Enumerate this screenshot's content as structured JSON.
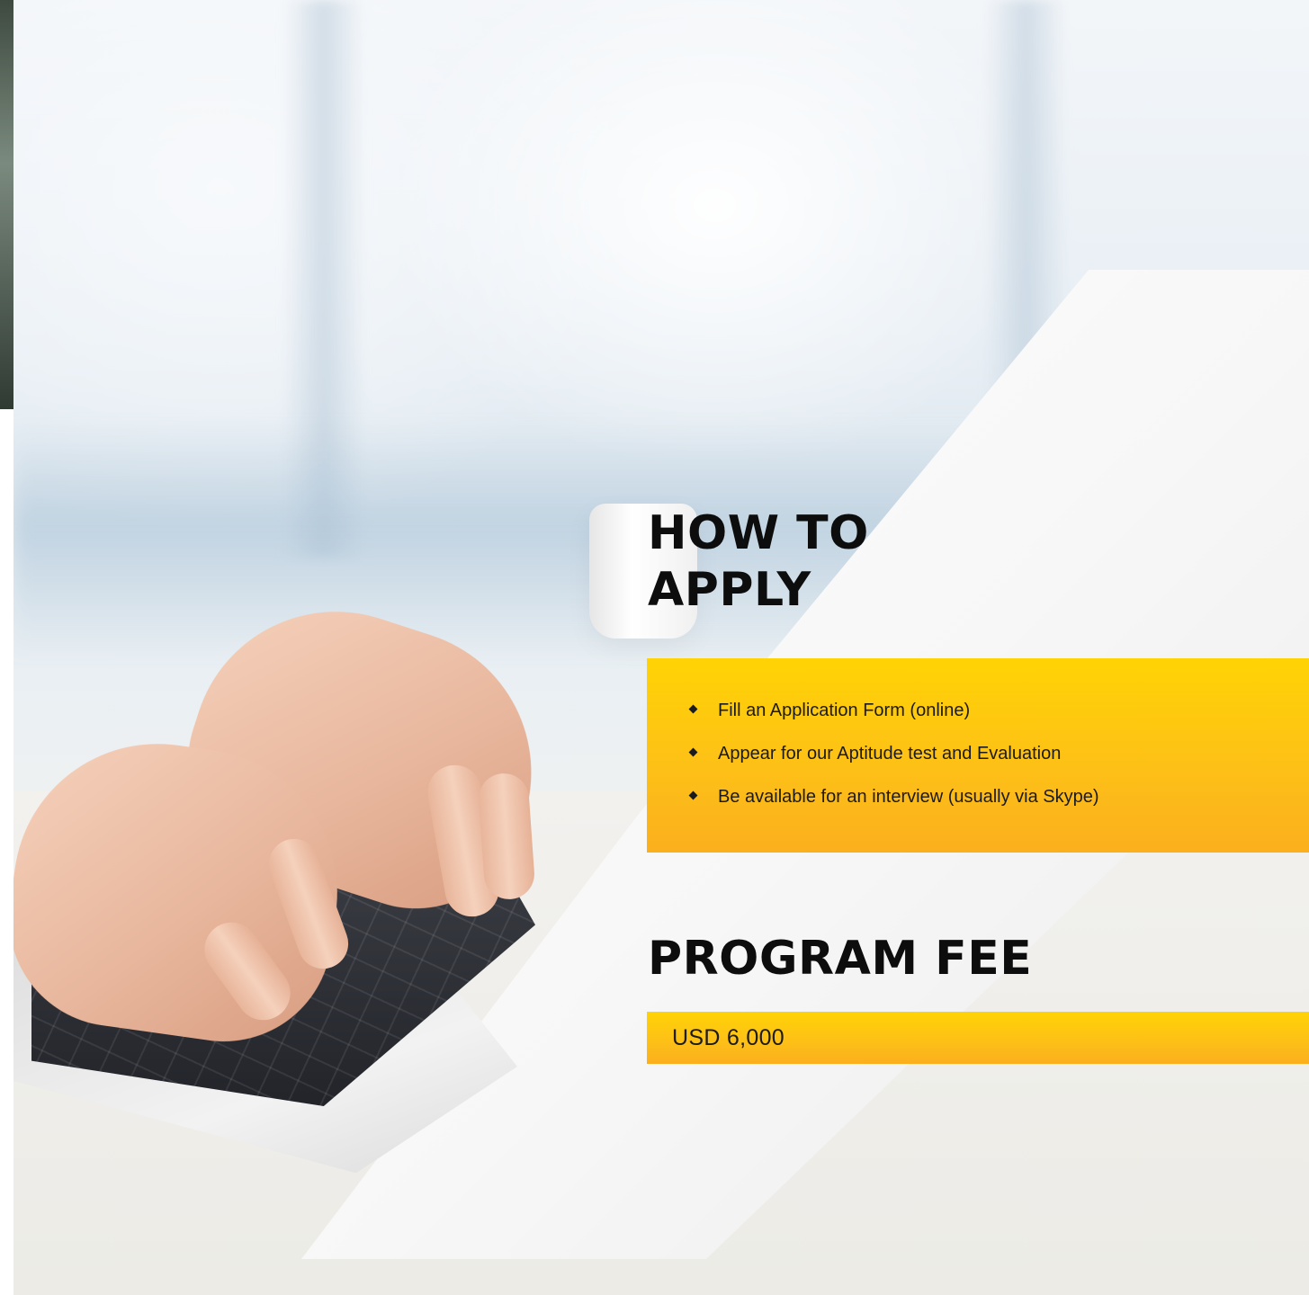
{
  "how_to_apply": {
    "title_line1": "HOW TO",
    "title_line2": "APPLY",
    "steps": [
      "Fill an Application Form (online)",
      "Appear for our Aptitude test and Evaluation",
      "Be available for an interview (usually via Skype)"
    ],
    "bullet_icon": "diamond-bullet-icon"
  },
  "program_fee": {
    "title": "PROGRAM FEE",
    "amount": "USD 6,000"
  },
  "colors": {
    "accent_yellow_top": "#ffd305",
    "accent_yellow_bottom": "#fbaf1d",
    "heading_text": "#0d0d0d",
    "body_text": "#1b1b1b"
  }
}
